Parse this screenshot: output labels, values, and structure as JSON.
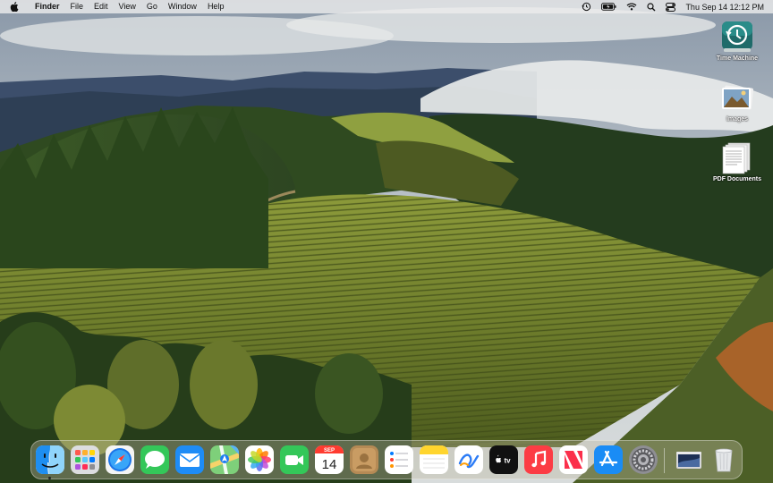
{
  "menubar": {
    "app_name": "Finder",
    "menus": [
      "File",
      "Edit",
      "View",
      "Go",
      "Window",
      "Help"
    ],
    "clock": "Thu Sep 14  12:12 PM"
  },
  "desktop": {
    "icons": [
      {
        "label": "Time Machine",
        "icon": "time-machine-icon"
      },
      {
        "label": "Images",
        "icon": "images-folder-icon"
      },
      {
        "label": "PDF Documents",
        "icon": "pdf-documents-icon"
      }
    ]
  },
  "dock": {
    "calendar": {
      "month": "SEP",
      "day": "14"
    },
    "apps": [
      "Finder",
      "Launchpad",
      "Safari",
      "Messages",
      "Mail",
      "Maps",
      "Photos",
      "FaceTime",
      "Calendar",
      "Contacts",
      "Reminders",
      "Notes",
      "Freeform",
      "TV",
      "Music",
      "News",
      "App Store",
      "System Settings",
      "Screen Saver Window",
      "Trash"
    ]
  },
  "colors": {
    "menubar_bg": "#ebebeb",
    "safari_blue": "#1b74e8",
    "messages_green": "#34c759",
    "music_red": "#fc3c44"
  }
}
